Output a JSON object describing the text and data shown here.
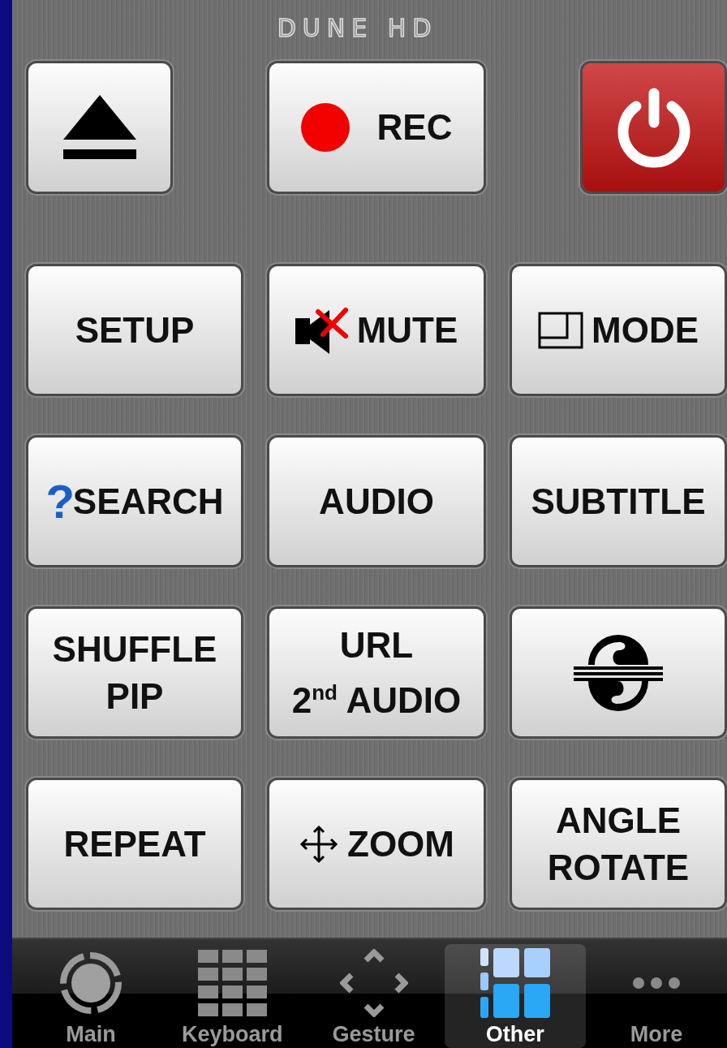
{
  "logo": "DUNE HD",
  "top_buttons": [
    {
      "kind": "icon"
    },
    {
      "kind": "icon_label",
      "label": "REC"
    },
    {
      "kind": "icon"
    }
  ],
  "buttons": [
    {
      "kind": "label",
      "lines": [
        "SETUP"
      ]
    },
    {
      "kind": "icon_label",
      "lines": [
        "MUTE"
      ]
    },
    {
      "kind": "icon_label",
      "lines": [
        "MODE"
      ]
    },
    {
      "kind": "label",
      "prefix": "?",
      "lines": [
        "SEARCH"
      ]
    },
    {
      "kind": "label",
      "lines": [
        "AUDIO"
      ]
    },
    {
      "kind": "label",
      "lines": [
        "SUBTITLE"
      ]
    },
    {
      "kind": "label",
      "lines": [
        "SHUFFLE",
        "PIP"
      ]
    },
    {
      "kind": "label",
      "lines": [
        "URL",
        "2$^{nd}$ AUDIO"
      ]
    },
    {
      "kind": "icon"
    },
    {
      "kind": "label",
      "lines": [
        "REPEAT"
      ]
    },
    {
      "kind": "icon_label",
      "lines": [
        "ZOOM"
      ]
    },
    {
      "kind": "label",
      "lines": [
        "ANGLE",
        "ROTATE"
      ]
    }
  ],
  "tabs": [
    {
      "label": "Main",
      "selected": false
    },
    {
      "label": "Keyboard",
      "selected": false
    },
    {
      "label": "Gesture",
      "selected": false
    },
    {
      "label": "Other",
      "selected": true
    },
    {
      "label": "More",
      "selected": false
    }
  ]
}
